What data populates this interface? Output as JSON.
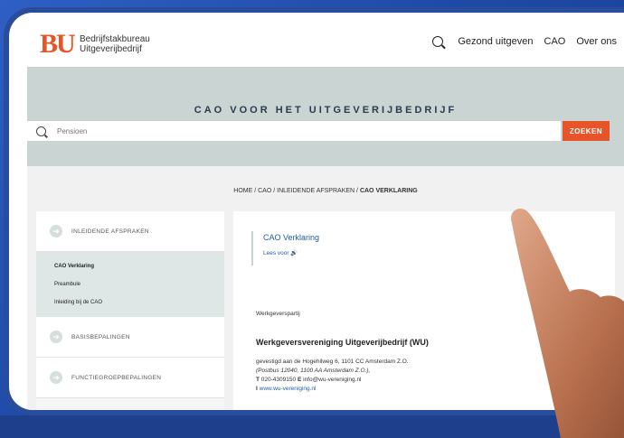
{
  "header": {
    "logo": "BU",
    "brand_line1": "Bedrijfstakbureau",
    "brand_line2": "Uitgeverijbedrijf",
    "nav": [
      "Gezond uitgeven",
      "CAO",
      "Over ons"
    ]
  },
  "hero": {
    "title": "CAO VOOR HET UITGEVERIJBEDRIJF",
    "search_placeholder": "Pensioen",
    "search_button": "ZOEKEN"
  },
  "breadcrumb": {
    "path": "HOME / CAO / INLEIDENDE AFSPRAKEN / ",
    "current": "CAO VERKLARING"
  },
  "sidebar": {
    "sections": [
      {
        "label": "INLEIDENDE AFSPRAKEN"
      },
      {
        "label": "BASISBEPALINGEN"
      },
      {
        "label": "FUNCTIEGROEPBEPALINGEN"
      }
    ],
    "sub_items": [
      "CAO Verklaring",
      "Preambule",
      "Inleiding bij de CAO"
    ]
  },
  "main": {
    "title": "CAO Verklaring",
    "lees_voor": "Lees voor",
    "werkgeverspartij": "Werkgeverspartij",
    "org": "Werkgeversvereniging Uitgeverijbedrijf (WU)",
    "address": "gevestigd aan de Hogehilweg 6, 1101 CC Amsterdam Z.O.",
    "postbus": "(Postbus 12040, 1100 AA Amsterdam Z.O.),",
    "t_label": "T",
    "phone": "020-4309150",
    "e_label": "E",
    "email": "info@wu-vereniging.nl",
    "i_label": "I",
    "website": "www.wu-vereniging.nl"
  },
  "colors": {
    "accent": "#e8542a",
    "hero_bg": "#c9d4d3",
    "link": "#1f5fa8",
    "frame": "#1e4aa6"
  }
}
